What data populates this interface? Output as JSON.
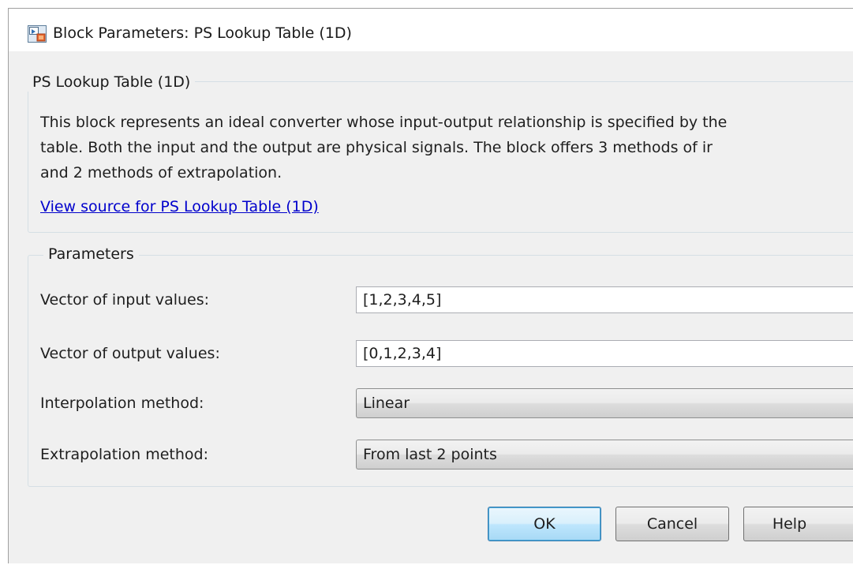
{
  "window": {
    "title": "Block Parameters: PS Lookup Table (1D)"
  },
  "description": {
    "legend": "PS Lookup Table (1D)",
    "lines": [
      "This block represents an ideal converter whose input-output relationship is specified by the",
      "table.  Both the input and the output are physical signals.  The block offers 3 methods of ir",
      "and 2 methods of extrapolation."
    ],
    "source_link": "View source for PS Lookup Table (1D)"
  },
  "parameters": {
    "legend": "Parameters",
    "input_values": {
      "label": "Vector of input values:",
      "value": "[1,2,3,4,5]"
    },
    "output_values": {
      "label": "Vector of output values:",
      "value": "[0,1,2,3,4]"
    },
    "interpolation": {
      "label": "Interpolation method:",
      "selected": "Linear"
    },
    "extrapolation": {
      "label": "Extrapolation method:",
      "selected": "From last 2 points"
    }
  },
  "buttons": {
    "ok": "OK",
    "cancel": "Cancel",
    "help": "Help"
  },
  "icons": {
    "title_icon": "simulink-block-icon"
  },
  "colors": {
    "link": "#0000cc",
    "dialog_background": "#f0f0f0",
    "default_button_border": "#3c7fb1"
  }
}
